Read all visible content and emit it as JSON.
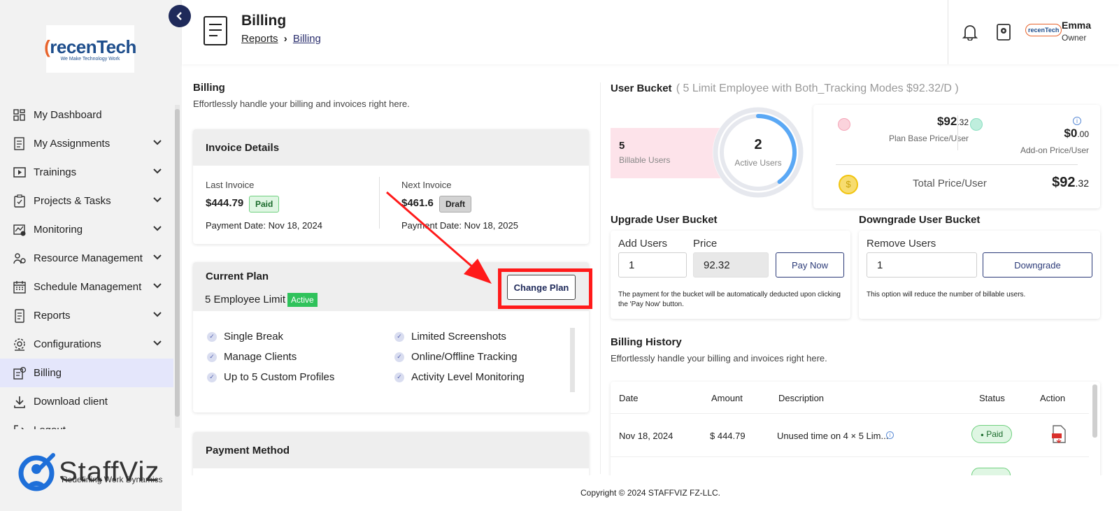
{
  "sidebar": {
    "logo_text": "recenTech",
    "logo_tagline": "We Make Technology Work",
    "items": [
      {
        "label": "My Dashboard",
        "icon": "dashboard-icon",
        "expandable": false
      },
      {
        "label": "My Assignments",
        "icon": "assignments-icon",
        "expandable": true
      },
      {
        "label": "Trainings",
        "icon": "trainings-icon",
        "expandable": true
      },
      {
        "label": "Projects & Tasks",
        "icon": "projects-icon",
        "expandable": true
      },
      {
        "label": "Monitoring",
        "icon": "monitoring-icon",
        "expandable": true
      },
      {
        "label": "Resource Management",
        "icon": "resource-icon",
        "expandable": true
      },
      {
        "label": "Schedule Management",
        "icon": "schedule-icon",
        "expandable": true
      },
      {
        "label": "Reports",
        "icon": "reports-icon",
        "expandable": true
      },
      {
        "label": "Configurations",
        "icon": "configurations-icon",
        "expandable": true
      },
      {
        "label": "Billing",
        "icon": "billing-icon",
        "expandable": false,
        "active": true
      },
      {
        "label": "Download client",
        "icon": "download-icon",
        "expandable": false
      },
      {
        "label": "Logout",
        "icon": "logout-icon",
        "expandable": false
      }
    ],
    "brand_name": "StaffViz",
    "brand_tagline": "Redefining Work Dynamics"
  },
  "header": {
    "title": "Billing",
    "breadcrumb": [
      "Reports",
      "Billing"
    ],
    "user_name": "Emma",
    "user_role": "Owner",
    "mini_logo": "recenTech"
  },
  "billing": {
    "heading": "Billing",
    "subheading": "Effortlessly handle your billing and invoices right here."
  },
  "invoice": {
    "title": "Invoice Details",
    "last_label": "Last Invoice",
    "last_amount": "$444.79",
    "last_status": "Paid",
    "last_date": "Payment Date: Nov 18, 2024",
    "next_label": "Next Invoice",
    "next_amount": "$461.6",
    "next_status": "Draft",
    "next_date": "Payment Date: Nov 18, 2025"
  },
  "plan": {
    "title": "Current Plan",
    "name": "5 Employee Limit",
    "status": "Active",
    "change_label": "Change Plan",
    "features_left": [
      "Single Break",
      "Manage Clients",
      "Up to 5 Custom Profiles"
    ],
    "features_right": [
      "Limited Screenshots",
      "Online/Offline Tracking",
      "Activity Level Monitoring"
    ]
  },
  "payment": {
    "title": "Payment Method"
  },
  "bucket": {
    "title": "User Bucket",
    "detail": "( 5 Limit Employee with Both_Tracking Modes $92.32/D )",
    "billable_count": "5",
    "billable_label": "Billable Users",
    "active_count": "2",
    "active_label": "Active Users",
    "active_fraction": 0.4,
    "base_price_main": "$92",
    "base_price_cents": ".32",
    "base_price_label": "Plan Base Price/User",
    "addon_price_main": "$0",
    "addon_price_cents": ".00",
    "addon_price_label": "Add-on Price/User",
    "total_label": "Total Price/User",
    "total_main": "$92",
    "total_cents": ".32"
  },
  "upgrade": {
    "title": "Upgrade User Bucket",
    "add_label": "Add Users",
    "add_value": "1",
    "price_label": "Price",
    "price_value": "92.32",
    "pay_label": "Pay Now",
    "note": "The payment for the bucket will be automatically deducted upon clicking the 'Pay Now' button."
  },
  "downgrade": {
    "title": "Downgrade User Bucket",
    "remove_label": "Remove Users",
    "remove_value": "1",
    "button_label": "Downgrade",
    "note": "This option will reduce the number of billable users."
  },
  "history": {
    "title": "Billing History",
    "subtitle": "Effortlessly handle your billing and invoices right here.",
    "columns": [
      "Date",
      "Amount",
      "Description",
      "Status",
      "Action"
    ],
    "rows": [
      {
        "date": "Nov 18, 2024",
        "amount": "$ 444.79",
        "description": "Unused time on 4 × 5 Lim...",
        "status": "Paid"
      }
    ]
  },
  "footer": {
    "copyright": "Copyright © 2024 STAFFVIZ FZ-LLC."
  },
  "colors": {
    "accent": "#2b3a78",
    "active_ring": "#5aa8f5",
    "annotation": "#ff1a1a",
    "billable_bg": "#fde3ea"
  }
}
